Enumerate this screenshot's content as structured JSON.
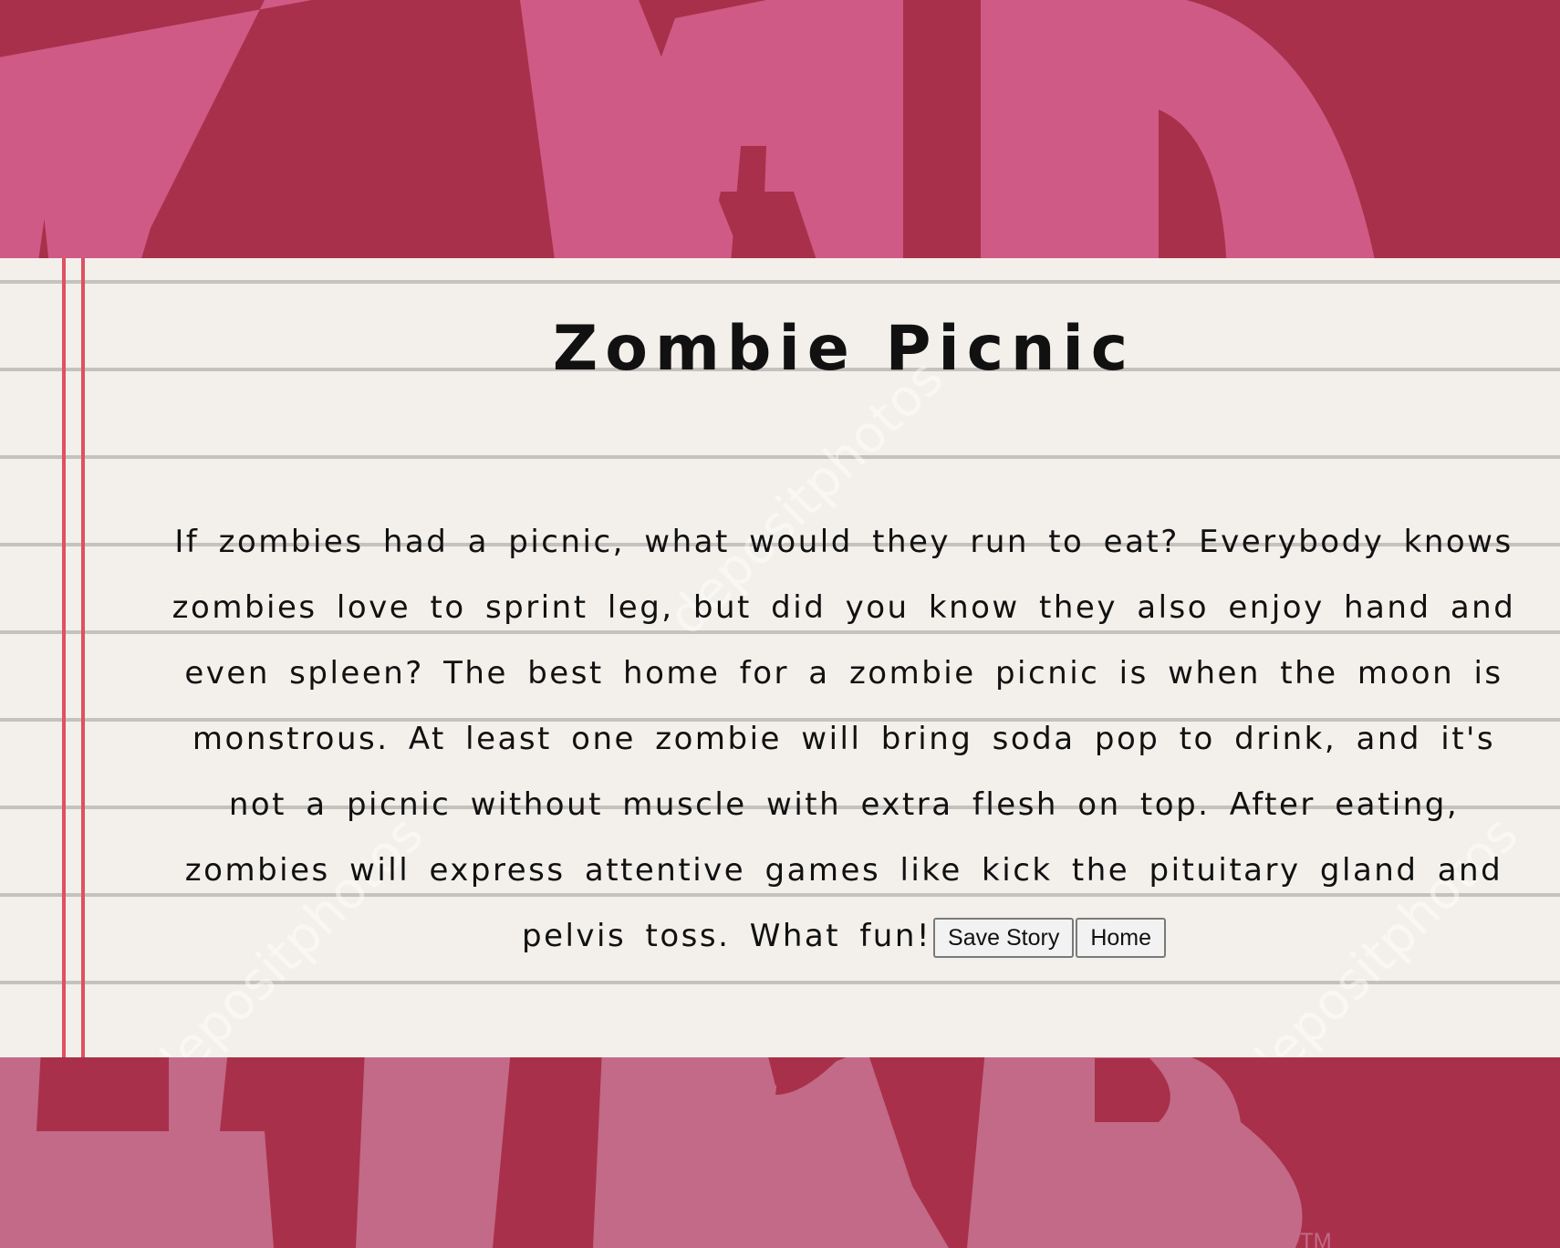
{
  "story": {
    "title": "Zombie Picnic",
    "text": "If zombies had a picnic, what would they run to eat? Everybody knows zombies love to sprint leg, but did you know they also enjoy hand and even spleen? The best home for a zombie picnic is when the moon is monstrous. At least one zombie will bring soda pop to drink, and it's not a picnic without muscle with extra flesh on top. After eating, zombies will express attentive games like kick the pituitary gland and pelvis toss. What fun!"
  },
  "buttons": {
    "save_label": "Save Story",
    "home_label": "Home"
  },
  "background": {
    "top_word": "MAD",
    "bottom_word": "LIBS",
    "trademark": "TM"
  },
  "watermark": {
    "text": "depositphotos"
  },
  "colors": {
    "background": "#a9304a",
    "letters_top": "#cf5a86",
    "letters_bottom": "#c26a88",
    "paper": "#f3f0eb",
    "margin_line": "#e0505e"
  }
}
